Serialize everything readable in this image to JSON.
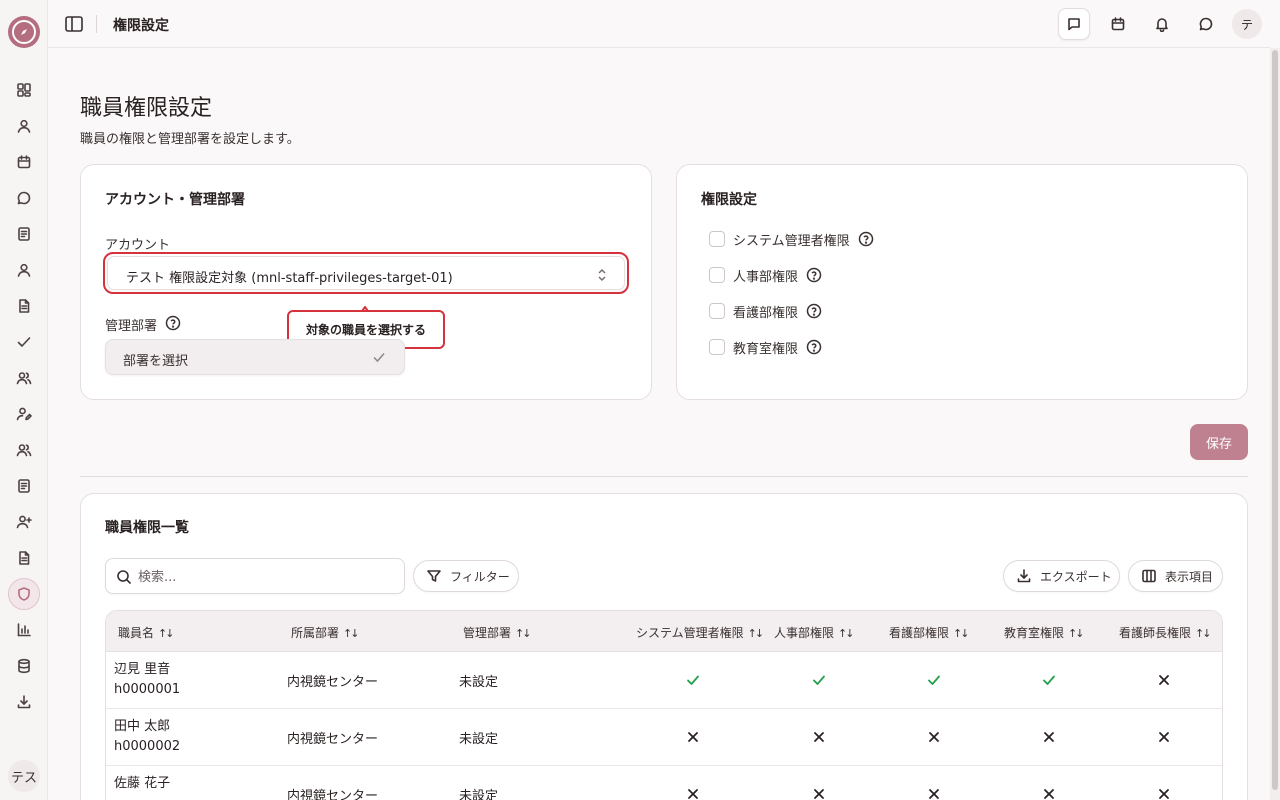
{
  "header": {
    "title": "権限設定"
  },
  "sidebar": {
    "icons": [
      "dashboard-icon",
      "user-icon",
      "calendar-icon",
      "chat-icon",
      "notebook-icon",
      "user-icon",
      "document-icon",
      "check-icon",
      "users-icon",
      "user-edit-icon",
      "users-icon",
      "notebook-icon",
      "user-plus-icon",
      "document-icon",
      "shield-icon",
      "bar-chart-icon",
      "database-icon",
      "download-icon"
    ],
    "avatar": "テス"
  },
  "user_avatar": "テ",
  "page": {
    "title": "職員権限設定",
    "subtitle": "職員の権限と管理部署を設定します。"
  },
  "account_card": {
    "title": "アカウント・管理部署",
    "account_label": "アカウント",
    "account_value": "テスト 権限設定対象 (mnl-staff-privileges-target-01)",
    "tooltip": "対象の職員を選択する",
    "dept_label": "管理部署",
    "dept_placeholder": "部署を選択"
  },
  "permission_card": {
    "title": "権限設定",
    "items": [
      {
        "label": "システム管理者権限",
        "checked": false
      },
      {
        "label": "人事部権限",
        "checked": false
      },
      {
        "label": "看護部権限",
        "checked": false
      },
      {
        "label": "教育室権限",
        "checked": false
      }
    ]
  },
  "save_label": "保存",
  "list_card": {
    "title": "職員権限一覧",
    "search_placeholder": "検索...",
    "filter_label": "フィルター",
    "export_label": "エクスポート",
    "columns_label": "表示項目",
    "sort_glyph": "↑↓",
    "headers": [
      "職員名",
      "所属部署",
      "管理部署",
      "システム管理者権限",
      "人事部権限",
      "看護部権限",
      "教育室権限",
      "看護師長権限"
    ],
    "rows": [
      {
        "name": "辺見 里音",
        "id": "h0000001",
        "dept": "内視鏡センター",
        "managed": "未設定",
        "perms": [
          true,
          true,
          true,
          true,
          false
        ]
      },
      {
        "name": "田中 太郎",
        "id": "h0000002",
        "dept": "内視鏡センター",
        "managed": "未設定",
        "perms": [
          false,
          false,
          false,
          false,
          false
        ]
      },
      {
        "name": "佐藤 花子",
        "id": "",
        "dept": "内視鏡センター",
        "managed": "未設定",
        "perms": [
          false,
          false,
          false,
          false,
          false
        ]
      }
    ]
  },
  "colors": {
    "accent": "#bf8090",
    "highlight": "#d6323d",
    "check": "#22a04b"
  }
}
